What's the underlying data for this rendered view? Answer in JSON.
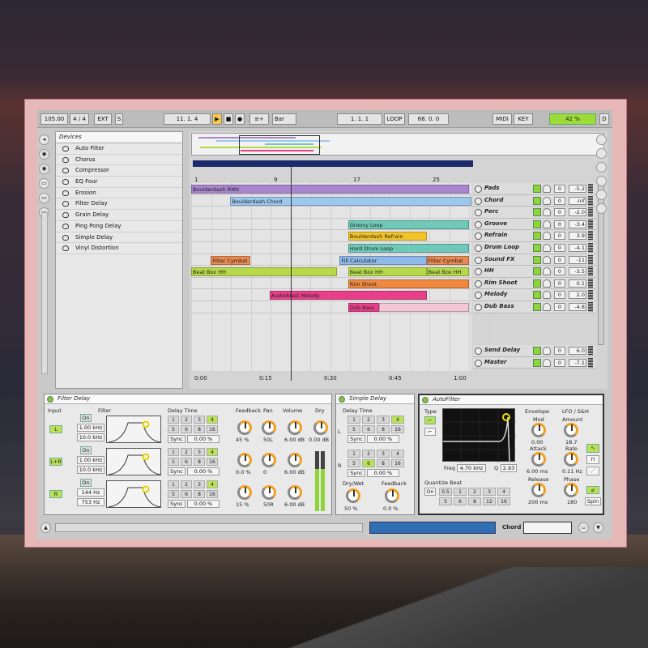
{
  "transport": {
    "tempo": "105.00",
    "signature": "4 / 4",
    "ext": "EXT",
    "s": "S",
    "position": "11. 1. 4",
    "follow": "≡+",
    "quant": "Bar",
    "loop_start": "1. 1. 1",
    "loop": "LOOP",
    "loop_len": "68. 0. 0",
    "midi": "MIDI",
    "key": "KEY",
    "cpu": "42 %",
    "d": "D"
  },
  "browser": {
    "header": "Devices",
    "items": [
      "Auto Filter",
      "Chorus",
      "Compressor",
      "EQ Four",
      "Erosion",
      "Filter Delay",
      "Grain Delay",
      "Ping Pong Delay",
      "Simple Delay",
      "Vinyl Distortion"
    ]
  },
  "ruler": [
    "1",
    "9",
    "17",
    "25"
  ],
  "time": [
    "0:00",
    "0:15",
    "0:30",
    "0:45",
    "1:00"
  ],
  "clips": [
    {
      "lane": 0,
      "start": 0,
      "end": 0.99,
      "name": "Boulderdash RMX",
      "color": "#a886cf"
    },
    {
      "lane": 1,
      "start": 0.14,
      "end": 1.0,
      "name": "Boulderdash Chord",
      "color": "#9cc8ee"
    },
    {
      "lane": 3,
      "start": 0.56,
      "end": 0.99,
      "name": "Groovy Loop",
      "color": "#6fc9b8"
    },
    {
      "lane": 4,
      "start": 0.56,
      "end": 0.84,
      "name": "Boulderdash Refrain",
      "color": "#f3c42a"
    },
    {
      "lane": 5,
      "start": 0.56,
      "end": 0.99,
      "name": "Hard Drum Loop",
      "color": "#6fc9b8"
    },
    {
      "lane": 6,
      "start": 0.07,
      "end": 0.21,
      "name": "Filter Cymbal",
      "color": "#e98a52"
    },
    {
      "lane": 6,
      "start": 0.53,
      "end": 0.84,
      "name": "Fill Calculator",
      "color": "#8fb9e8"
    },
    {
      "lane": 6,
      "start": 0.84,
      "end": 0.99,
      "name": "Filter Cymbal",
      "color": "#e98a52"
    },
    {
      "lane": 7,
      "start": 0,
      "end": 0.52,
      "name": "Beat Box HH",
      "color": "#b5d94a"
    },
    {
      "lane": 7,
      "start": 0.56,
      "end": 0.84,
      "name": "Beat Box HH",
      "color": "#b5d94a"
    },
    {
      "lane": 7,
      "start": 0.84,
      "end": 0.99,
      "name": "Beat Box HH",
      "color": "#b5d94a"
    },
    {
      "lane": 8,
      "start": 0.56,
      "end": 0.99,
      "name": "Rim Shoot",
      "color": "#f08840"
    },
    {
      "lane": 9,
      "start": 0.28,
      "end": 0.84,
      "name": "Audioblast Melody",
      "color": "#e93f8a"
    },
    {
      "lane": 10,
      "start": 0.56,
      "end": 0.67,
      "name": "Dub Bass",
      "color": "#e93f8a"
    },
    {
      "lane": 10,
      "start": 0.67,
      "end": 0.99,
      "name": "",
      "color": "#f4c7d6"
    }
  ],
  "tracks": [
    {
      "name": "Pads",
      "vol": "-5.2",
      "send": "0"
    },
    {
      "name": "Chord",
      "vol": "-inf",
      "send": "0"
    },
    {
      "name": "Perc",
      "vol": "-2.0",
      "send": "0"
    },
    {
      "name": "Groove",
      "vol": "-3.4",
      "send": "0"
    },
    {
      "name": "Refrain",
      "vol": "3.9",
      "send": "0"
    },
    {
      "name": "Drum Loop",
      "vol": "-4.1",
      "send": "0"
    },
    {
      "name": "Sound FX",
      "vol": "-11",
      "send": "0"
    },
    {
      "name": "HH",
      "vol": "-3.5",
      "send": "0"
    },
    {
      "name": "Rim Shoot",
      "vol": "0.1",
      "send": "0"
    },
    {
      "name": "Melody",
      "vol": "2.0",
      "send": "0"
    },
    {
      "name": "Dub Bass",
      "vol": "-4.8",
      "send": "0"
    }
  ],
  "returns": [
    {
      "name": "Send Delay",
      "vol": "6.0",
      "send": "0"
    },
    {
      "name": "Master",
      "vol": "-7.1",
      "send": "0"
    }
  ],
  "filter_delay": {
    "title": "Filter Delay",
    "input": "Input",
    "filter": "Filter",
    "delay_time": "Delay Time",
    "feedback": "Feedback",
    "pan": "Pan",
    "volume": "Volume",
    "dry": "Dry",
    "rows": [
      {
        "ch": "L",
        "on": "On",
        "f1": "1.00 kHz",
        "f2": "10.0 kHz",
        "sync": "Sync",
        "pct": "0.00 %",
        "fb": "45 %",
        "pan": "50L",
        "vol": "6.00 dB",
        "dry": "0.00 dB"
      },
      {
        "ch": "L+R",
        "on": "On",
        "f1": "1.00 kHz",
        "f2": "10.0 kHz",
        "sync": "Sync",
        "pct": "0.00 %",
        "fb": "0.0 %",
        "pan": "0",
        "vol": "6.00 dB",
        "dry": ""
      },
      {
        "ch": "R",
        "on": "On",
        "f1": "144 Hz",
        "f2": "753 Hz",
        "sync": "Sync",
        "pct": "0.00 %",
        "fb": "15 %",
        "pan": "50R",
        "vol": "6.00 dB",
        "dry": ""
      }
    ],
    "grid": [
      "1",
      "2",
      "3",
      "4",
      "5",
      "6",
      "8",
      "16"
    ]
  },
  "simple_delay": {
    "title": "Simple Delay",
    "delay_time": "Delay Time",
    "l": "L",
    "r": "R",
    "sync": "Sync",
    "pct": "0.00 %",
    "drywet": "Dry/Wet",
    "feedback": "Feedback",
    "drywet_val": "50 %",
    "fb_val": "0.0 %",
    "grid": [
      "1",
      "2",
      "3",
      "4",
      "5",
      "6",
      "8",
      "16"
    ]
  },
  "auto_filter": {
    "title": "AutoFilter",
    "type": "Type",
    "freq_label": "Freq",
    "freq": "4.70 kHz",
    "q_label": "Q",
    "q": "2.93",
    "envelope": "Envelope",
    "mod": "Mod",
    "mod_val": "0.00",
    "attack": "Attack",
    "attack_val": "6.00 ms",
    "release": "Release",
    "release_val": "200 ms",
    "lfo": "LFO / S&H",
    "amount": "Amount",
    "amount_val": "18.7",
    "rate": "Rate",
    "rate_val": "0.11 Hz",
    "phase": "Phase",
    "phase_val": "180",
    "spin": "Spin",
    "quantize": "Quantize Beat",
    "on": "On",
    "qgrid": [
      "0.5",
      "1",
      "2",
      "3",
      "4",
      "5",
      "6",
      "8",
      "12",
      "16"
    ]
  },
  "bottom": {
    "track": "Chord"
  }
}
